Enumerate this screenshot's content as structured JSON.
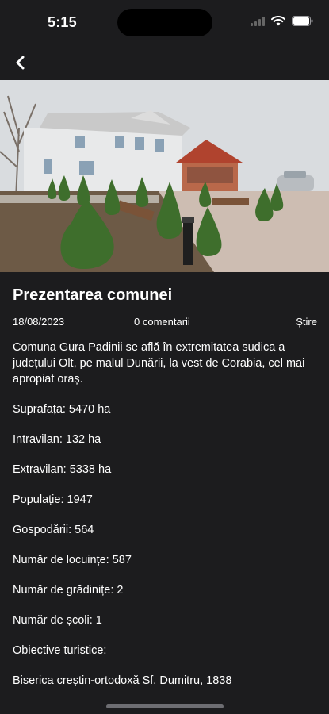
{
  "status_bar": {
    "time": "5:15",
    "icons": [
      "signal-icon",
      "wifi-icon",
      "battery-icon"
    ]
  },
  "nav": {
    "back_icon": "chevron-left-icon"
  },
  "article": {
    "image": "hero-photo-town-hall",
    "title": "Prezentarea comunei",
    "date": "18/08/2023",
    "comments": "0 comentarii",
    "category": "Știre",
    "intro": "Comuna Gura Padinii se află în extremitatea sudica a județului Olt, pe malul Dunării, la vest de Corabia, cel mai apropiat oraș.",
    "facts": [
      "Suprafața: 5470 ha",
      "Intravilan: 132 ha",
      "Extravilan: 5338 ha",
      "Populație: 1947",
      "Gospodării: 564",
      "Număr de locuințe: 587",
      "Număr de grădinițe: 2",
      "Număr de școli: 1",
      "Obiective turistice:",
      "Biserica creștin-ortodoxă Sf. Dumitru, 1838"
    ]
  },
  "colors": {
    "background": "#1c1c1e",
    "text": "#ffffff"
  }
}
